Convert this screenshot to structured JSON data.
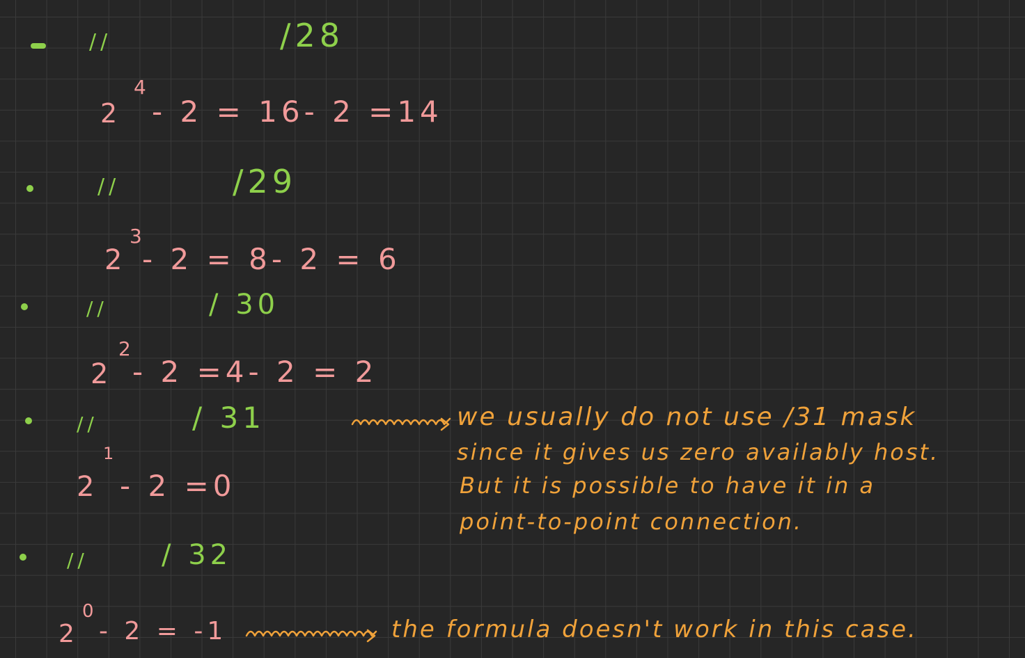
{
  "lines": {
    "l1": {
      "ditto": "//",
      "mask": "/28"
    },
    "e1": {
      "base": "2",
      "exp": "4",
      "rest": "- 2 = 16- 2 =14"
    },
    "l2": {
      "ditto": "//",
      "mask": "/29"
    },
    "e2": {
      "base": "2",
      "exp": "3",
      "rest": "- 2 = 8- 2 = 6"
    },
    "l3": {
      "ditto": "//",
      "mask": "/ 30"
    },
    "e3": {
      "base": "2",
      "exp": "2",
      "rest": "- 2 =4- 2 = 2"
    },
    "l4": {
      "ditto": "//",
      "mask": "/ 31"
    },
    "e4": {
      "base": "2",
      "exp": "1",
      "rest": "- 2 =0"
    },
    "l5": {
      "ditto": "//",
      "mask": "/ 32"
    },
    "e5": {
      "base": "2",
      "exp": "0",
      "rest": "- 2 = -1"
    }
  },
  "notes": {
    "n1a": "we usually do not use /31 mask",
    "n1b": "since it gives us zero availably host.",
    "n1c": "But it is possible to have it in a",
    "n1d": "point-to-point connection.",
    "n2": "the formula doesn't work in this case."
  },
  "colors": {
    "background": "#262626",
    "grid": "#3a3a3a",
    "green": "#8ed04b",
    "pink": "#f19a9a",
    "orange": "#f0a23a"
  }
}
